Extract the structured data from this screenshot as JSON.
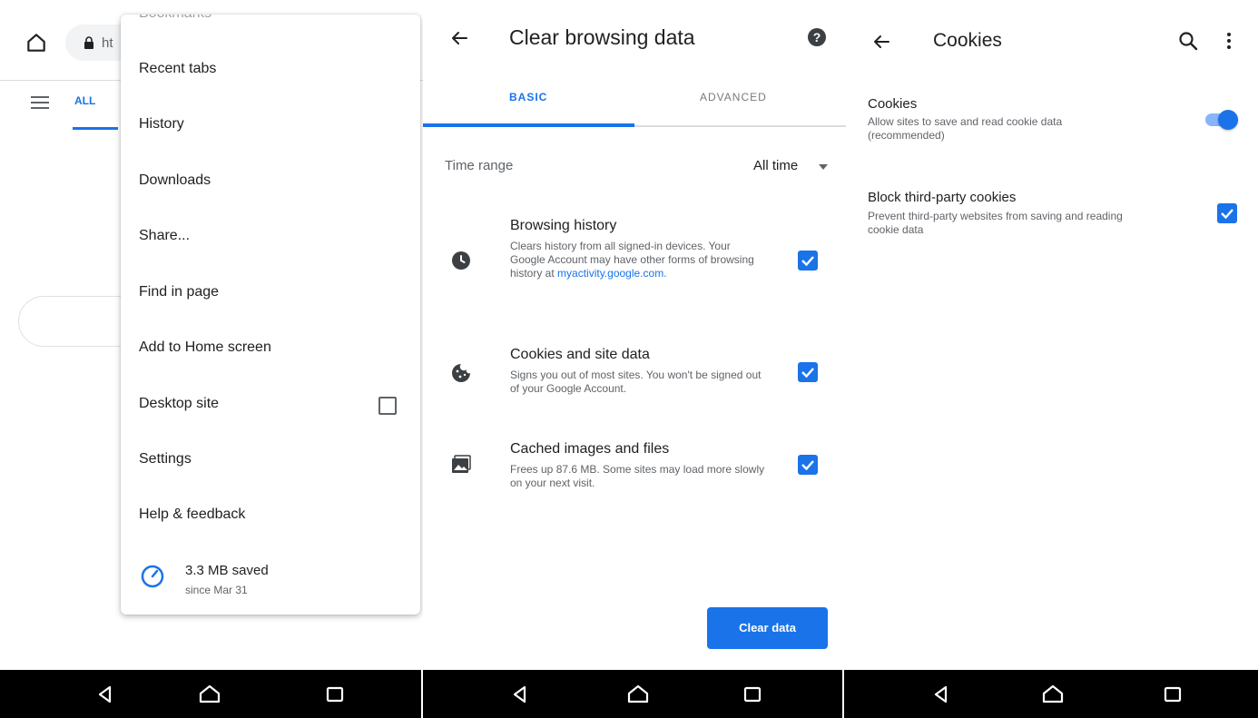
{
  "panel_browser": {
    "url_text": "ht",
    "tab_all": "ALL",
    "menu": {
      "cutoff_item": "Bookmarks",
      "items": [
        "Recent tabs",
        "History",
        "Downloads",
        "Share...",
        "Find in page",
        "Add to Home screen",
        "Desktop site",
        "Settings",
        "Help & feedback"
      ],
      "desktop_site_checked": false,
      "data_saver": {
        "title": "3.3 MB saved",
        "subtitle": "since Mar 31"
      }
    }
  },
  "panel_clear": {
    "title": "Clear browsing data",
    "tabs": [
      "BASIC",
      "ADVANCED"
    ],
    "active_tab": "BASIC",
    "time_range_label": "Time range",
    "time_range_value": "All time",
    "items": [
      {
        "title": "Browsing history",
        "description": "Clears history from all signed-in devices. Your Google Account may have other forms of browsing history at",
        "link": "myactivity.google.com.",
        "icon": "clock-icon",
        "checked": true
      },
      {
        "title": "Cookies and site data",
        "description": "Signs you out of most sites. You won't be signed out of your Google Account.",
        "icon": "cookie-icon",
        "checked": true
      },
      {
        "title": "Cached images and files",
        "description": "Frees up 87.6 MB. Some sites may load more slowly on your next visit.",
        "icon": "image-icon",
        "checked": true
      }
    ],
    "clear_button": "Clear data"
  },
  "panel_cookies": {
    "title": "Cookies",
    "prefs": [
      {
        "title": "Cookies",
        "description": "Allow sites to save and read cookie data (recommended)",
        "control": "toggle",
        "on": true
      },
      {
        "title": "Block third-party cookies",
        "description": "Prevent third-party websites from saving and reading cookie data",
        "control": "checkbox",
        "checked": true
      }
    ]
  },
  "colors": {
    "accent": "#1a73e8",
    "nav_bar": "#000000",
    "text_primary": "#202124",
    "text_secondary": "#5f6368"
  },
  "nav_icons": [
    "back-icon",
    "home-icon",
    "recents-icon"
  ]
}
